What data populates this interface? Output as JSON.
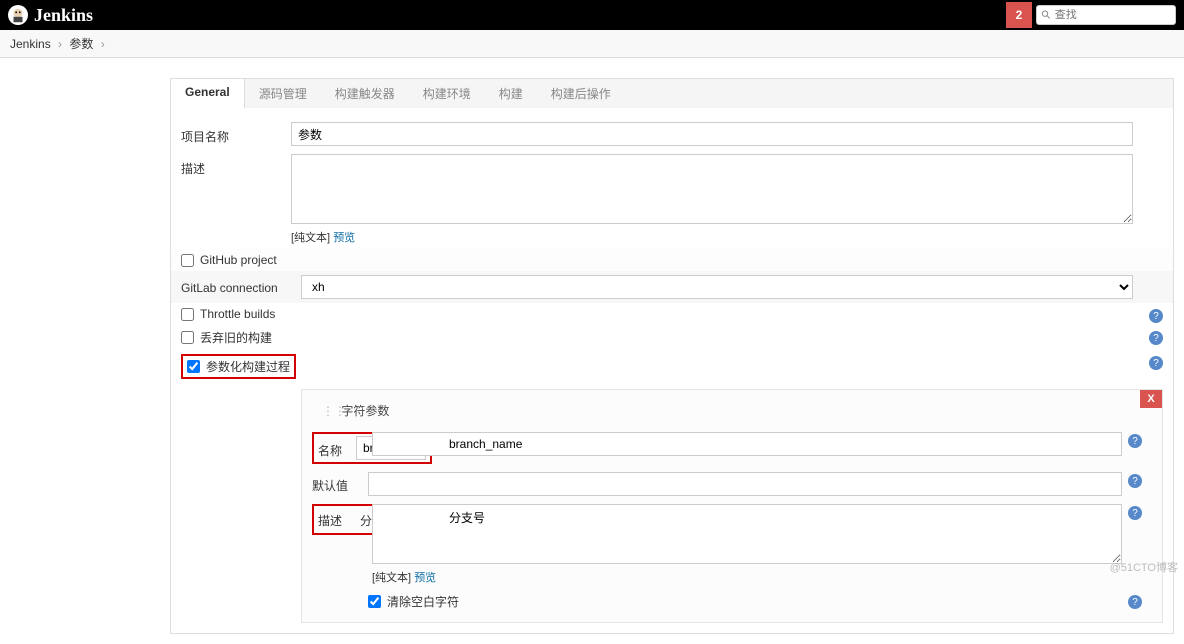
{
  "header": {
    "brand": "Jenkins",
    "notification_count": "2",
    "search_placeholder": "查找"
  },
  "breadcrumb": {
    "items": [
      "Jenkins",
      "参数"
    ]
  },
  "tabs": [
    "General",
    "源码管理",
    "构建触发器",
    "构建环境",
    "构建",
    "构建后操作"
  ],
  "form": {
    "project_name_label": "项目名称",
    "project_name_value": "参数",
    "description_label": "描述",
    "description_value": "",
    "plaintext_label": "[纯文本]",
    "preview_label": "预览",
    "github_project_label": "GitHub project",
    "gitlab_connection_label": "GitLab connection",
    "gitlab_connection_value": "xh",
    "throttle_builds_label": "Throttle builds",
    "discard_old_builds_label": "丢弃旧的构建",
    "parameterize_label": "参数化构建过程"
  },
  "param_section": {
    "title": "字符参数",
    "name_label": "名称",
    "name_value": "branch_name",
    "default_label": "默认值",
    "default_value": "",
    "desc_label": "描述",
    "desc_value": "分支号",
    "plaintext_label": "[纯文本]",
    "preview_label": "预览",
    "trim_label": "清除空白字符",
    "close_label": "X"
  },
  "watermark": "@51CTO博客"
}
